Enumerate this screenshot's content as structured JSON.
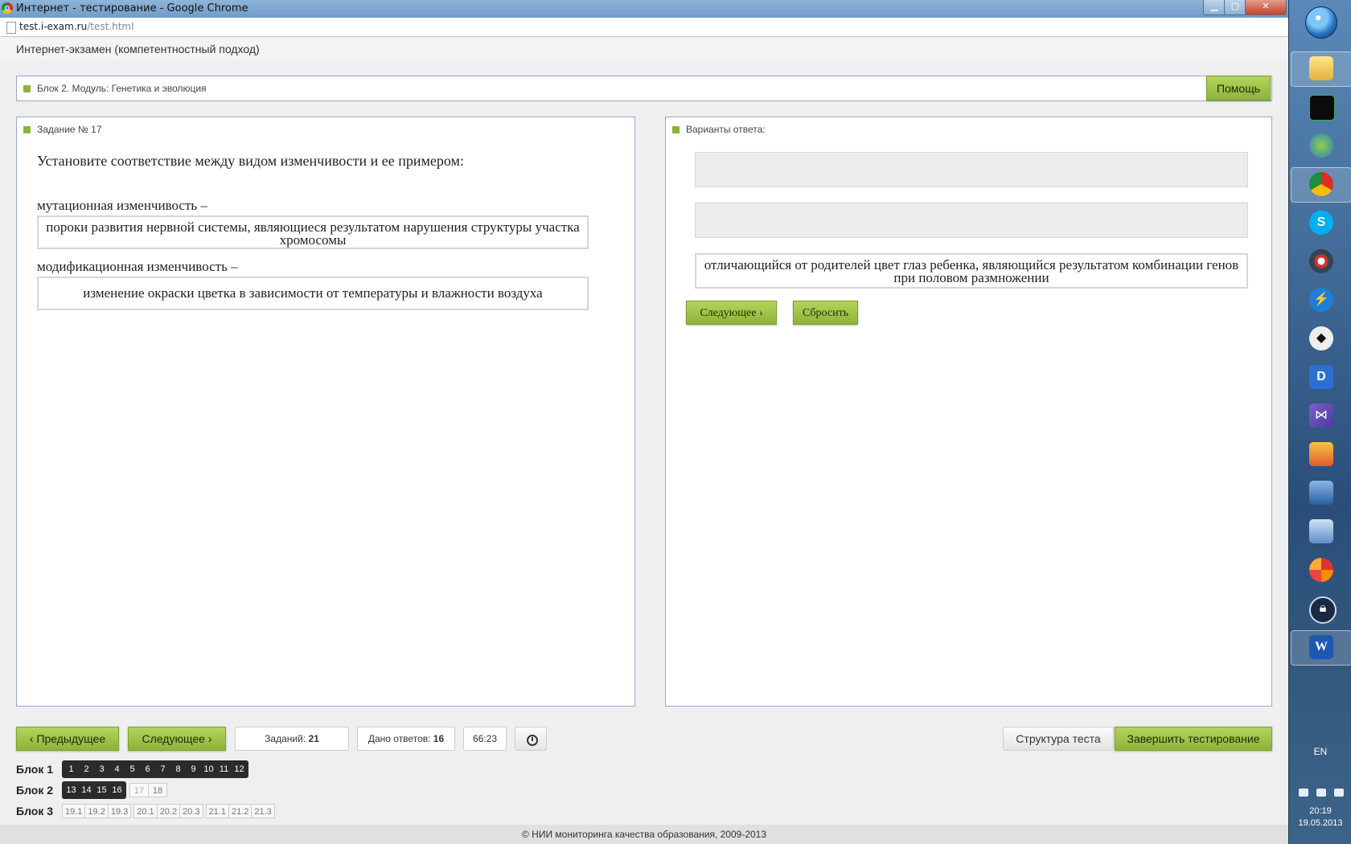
{
  "browser": {
    "window_title": "Интернет - тестирование - Google Chrome",
    "url_host": "test.i-exam.ru",
    "url_path": "/test.html",
    "controls": {
      "minimize": "▁",
      "maximize": "▢",
      "close": "✕"
    }
  },
  "header": {
    "title": "Интернет-экзамен (компетентностный подход)"
  },
  "block": {
    "label": "Блок 2. Модуль: Генетика и эволюция",
    "help_button": "Помощь"
  },
  "task": {
    "label": "Задание № 17",
    "question": "Установите соответствие между видом изменчивости и ее примером:",
    "pairs": [
      {
        "term": "мутационная изменчивость –",
        "answer": "пороки развития нервной системы, являющиеся результатом нарушения структуры участка хромосомы"
      },
      {
        "term": "модификационная изменчивость –",
        "answer": "изменение окраски цветка в зависимости от температуры и влажности воздуха"
      }
    ]
  },
  "answers": {
    "label": "Варианты ответа:",
    "options": [
      "",
      "",
      "отличающийся  от родителей цвет глаз ребенка, являющийся результатом комбинации генов при половом размножении"
    ],
    "next_button": "Следующее",
    "reset_button": "Сбросить"
  },
  "toolbar": {
    "prev_button": "Предыдущее",
    "next_button": "Следующее",
    "tasks_label": "Заданий:",
    "tasks_value": "21",
    "answered_label": "Дано ответов:",
    "answered_value": "16",
    "timer": "66:23",
    "structure_button": "Структура теста",
    "finish_button": "Завершить тестирование"
  },
  "navigator": {
    "block1": {
      "label": "Блок 1",
      "answered": [
        "1",
        "2",
        "3",
        "4",
        "5",
        "6",
        "7",
        "8",
        "9",
        "10",
        "11",
        "12"
      ]
    },
    "block2": {
      "label": "Блок 2",
      "answered": [
        "13",
        "14",
        "15",
        "16"
      ],
      "current": "17",
      "unanswered": [
        "18"
      ]
    },
    "block3": {
      "label": "Блок 3",
      "groups": [
        [
          "19.1",
          "19.2",
          "19.3"
        ],
        [
          "20.1",
          "20.2",
          "20.3"
        ],
        [
          "21.1",
          "21.2",
          "21.3"
        ]
      ]
    }
  },
  "footer": {
    "copyright": "© НИИ мониторинга качества образования, 2009-2013"
  },
  "taskbar": {
    "language": "EN",
    "time": "20:19",
    "date": "19.05.2013"
  },
  "colors": {
    "accent_green": "#8db33a",
    "panel_border": "#9aa6cc",
    "nav_dark": "#2b2b2b"
  }
}
